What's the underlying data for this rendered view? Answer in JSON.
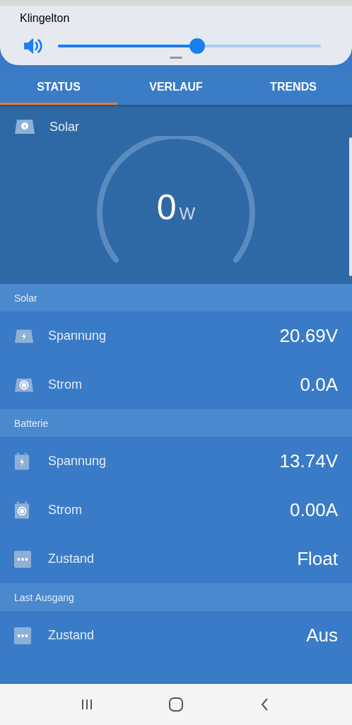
{
  "volume_panel": {
    "label": "Klingelton",
    "level": 0.53
  },
  "tabs": [
    {
      "label": "STATUS",
      "selected": true
    },
    {
      "label": "VERLAUF",
      "selected": false
    },
    {
      "label": "TRENDS",
      "selected": false
    }
  ],
  "gauge": {
    "title": "Solar",
    "value": "0",
    "unit": "W"
  },
  "sections": [
    {
      "title": "Solar",
      "rows": [
        {
          "kind": "panel-voltage",
          "label": "Spannung",
          "value": "20.69V"
        },
        {
          "kind": "panel-current",
          "label": "Strom",
          "value": "0.0A"
        }
      ]
    },
    {
      "title": "Batterie",
      "rows": [
        {
          "kind": "battery-voltage",
          "label": "Spannung",
          "value": "13.74V"
        },
        {
          "kind": "battery-current",
          "label": "Strom",
          "value": "0.00A"
        },
        {
          "kind": "state",
          "label": "Zustand",
          "value": "Float"
        }
      ]
    },
    {
      "title": "Last Ausgang",
      "rows": [
        {
          "kind": "state",
          "label": "Zustand",
          "value": "Aus"
        }
      ]
    }
  ]
}
